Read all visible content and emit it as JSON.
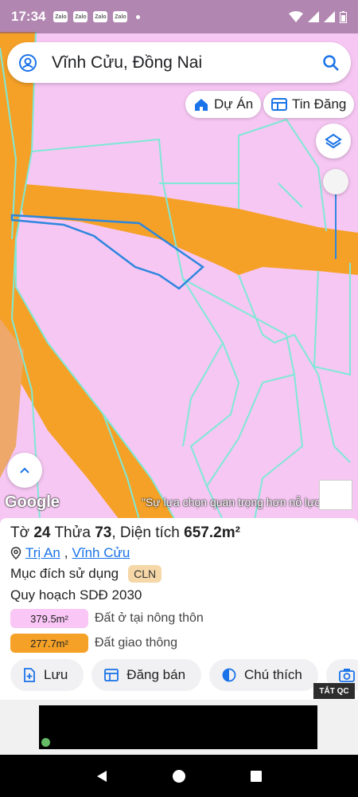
{
  "status_bar": {
    "time": "17:34",
    "notification_apps": [
      "Zalo",
      "Zalo",
      "Zalo",
      "Zalo"
    ]
  },
  "search": {
    "query": "Vĩnh Cửu, Đồng Nai",
    "account_icon": "account-icon",
    "search_icon": "search-icon"
  },
  "map_buttons": {
    "du_an_label": "Dự Án",
    "tin_dang_label": "Tin Đăng"
  },
  "map": {
    "attribution": "Google",
    "overlay_quote": "\"Sự lựa chọn quan trọng hơn nỗ lực\"",
    "colors": {
      "residential": "#f6c7f3",
      "road": "#f5a127",
      "parcel_border": "#7fe8d6",
      "selected_parcel": "#2e86de"
    }
  },
  "parcel": {
    "sheet_label": "Tờ",
    "sheet_no": "24",
    "plot_label": "Thửa",
    "plot_no": "73",
    "area_label": "Diện tích",
    "area_value": "657.2m²",
    "location_ward": "Trị An",
    "location_district": "Vĩnh Cửu",
    "purpose_label": "Mục đích sử dụng",
    "purpose_code": "CLN",
    "plan_label": "Quy hoạch SDĐ 2030",
    "legend": [
      {
        "area": "379.5m²",
        "label": "Đất ở tại nông thôn",
        "color": "#f9c6f5"
      },
      {
        "area": "277.7m²",
        "label": "Đất giao thông",
        "color": "#f5a127"
      }
    ]
  },
  "actions": {
    "save": "Lưu",
    "post_sale": "Đăng bán",
    "legend": "Chú thích"
  },
  "ad": {
    "close_label": "TẮT QC"
  }
}
